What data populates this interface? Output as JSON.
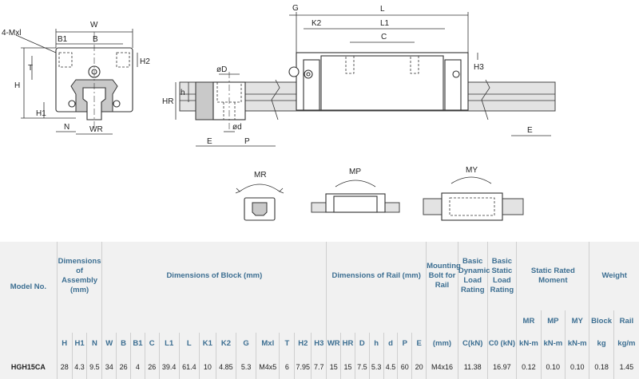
{
  "drawing": {
    "labels": {
      "W": "W",
      "B1": "B1",
      "B": "B",
      "Mxl": "4-Mxl",
      "T": "T",
      "H2": "H2",
      "H": "H",
      "H1": "H1",
      "N": "N",
      "WR": "WR",
      "G": "G",
      "K2": "K2",
      "L": "L",
      "L1": "L1",
      "C": "C",
      "H3": "H3",
      "D": "øD",
      "HR": "HR",
      "h": "h",
      "d": "ød",
      "E": "E",
      "P": "P"
    },
    "moments": {
      "MR": "MR",
      "MP": "MP",
      "MY": "MY"
    }
  },
  "table": {
    "model_header": "Model No.",
    "groups": {
      "assembly": "Dimensions of Assembly (mm)",
      "block": "Dimensions of Block (mm)",
      "rail": "Dimensions of Rail (mm)",
      "bolt": "Mounting Bolt for Rail",
      "dyn": "Basic Dynamic Load Rating",
      "stat": "Basic Static Load Rating",
      "moment": "Static Rated Moment",
      "weight": "Weight"
    },
    "moment_sub": [
      "MR",
      "MP",
      "MY"
    ],
    "weight_sub": [
      "Block",
      "Rail"
    ],
    "columns": [
      "H",
      "H1",
      "N",
      "W",
      "B",
      "B1",
      "C",
      "L1",
      "L",
      "K1",
      "K2",
      "G",
      "Mxl",
      "T",
      "H2",
      "H3",
      "WR",
      "HR",
      "D",
      "h",
      "d",
      "P",
      "E",
      "(mm)",
      "C(kN)",
      "C0 (kN)",
      "kN-m",
      "kN-m",
      "kN-m",
      "kg",
      "kg/m"
    ],
    "row": {
      "model": "HGH15CA",
      "values": [
        "28",
        "4.3",
        "9.5",
        "34",
        "26",
        "4",
        "26",
        "39.4",
        "61.4",
        "10",
        "4.85",
        "5.3",
        "M4x5",
        "6",
        "7.95",
        "7.7",
        "15",
        "15",
        "7.5",
        "5.3",
        "4.5",
        "60",
        "20",
        "M4x16",
        "11.38",
        "16.97",
        "0.12",
        "0.10",
        "0.10",
        "0.18",
        "1.45"
      ]
    }
  }
}
